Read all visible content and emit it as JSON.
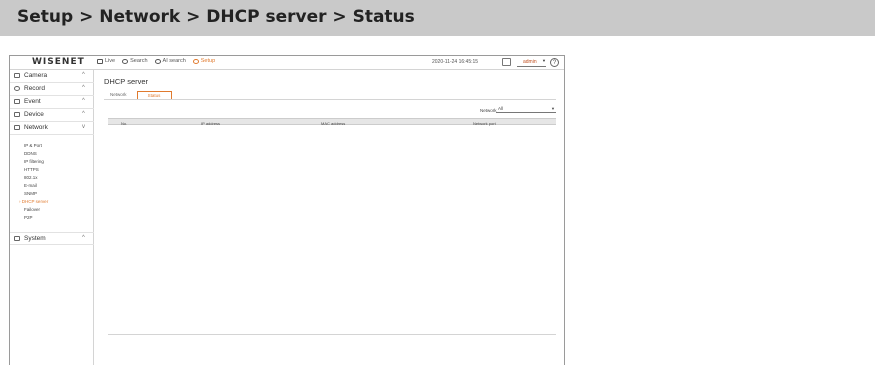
{
  "heading": "Setup > Network > DHCP server > Status",
  "app": {
    "logo": "WISENET",
    "nav": [
      {
        "label": "Live",
        "icon": "monitor-icon",
        "active": false
      },
      {
        "label": "Search",
        "icon": "search-icon",
        "active": false
      },
      {
        "label": "AI search",
        "icon": "ai-search-icon",
        "active": false
      },
      {
        "label": "Setup",
        "icon": "gear-icon",
        "active": true
      }
    ],
    "datetime": "2020-11-24 16:45:15",
    "user": "admin",
    "help": "?"
  },
  "sidebar": {
    "menus": [
      {
        "label": "Camera",
        "icon": "camera-icon",
        "chevron": "^"
      },
      {
        "label": "Record",
        "icon": "record-icon",
        "chevron": "^"
      },
      {
        "label": "Event",
        "icon": "event-icon",
        "chevron": "^"
      },
      {
        "label": "Device",
        "icon": "device-icon",
        "chevron": "^"
      },
      {
        "label": "Network",
        "icon": "network-icon",
        "chevron": "v"
      }
    ],
    "network_items": [
      "IP & Port",
      "DDNS",
      "IP filtering",
      "HTTPS",
      "802.1x",
      "E-mail",
      "SNMP",
      "DHCP server",
      "Failover",
      "P2P"
    ],
    "active_item": "DHCP server",
    "system": {
      "label": "System",
      "icon": "system-icon",
      "chevron": "^"
    }
  },
  "main": {
    "title": "DHCP server",
    "tabs": [
      {
        "label": "Network",
        "active": false
      },
      {
        "label": "Status",
        "active": true
      }
    ],
    "filter": {
      "label": "Network",
      "value": "All"
    },
    "table": {
      "columns": [
        "No.",
        "IP address",
        "MAC address",
        "Network port"
      ],
      "rows": []
    }
  },
  "colors": {
    "accent": "#e07a2e",
    "heading_bg": "#c9c9c9",
    "table_header_bg": "#e6e6e6"
  }
}
